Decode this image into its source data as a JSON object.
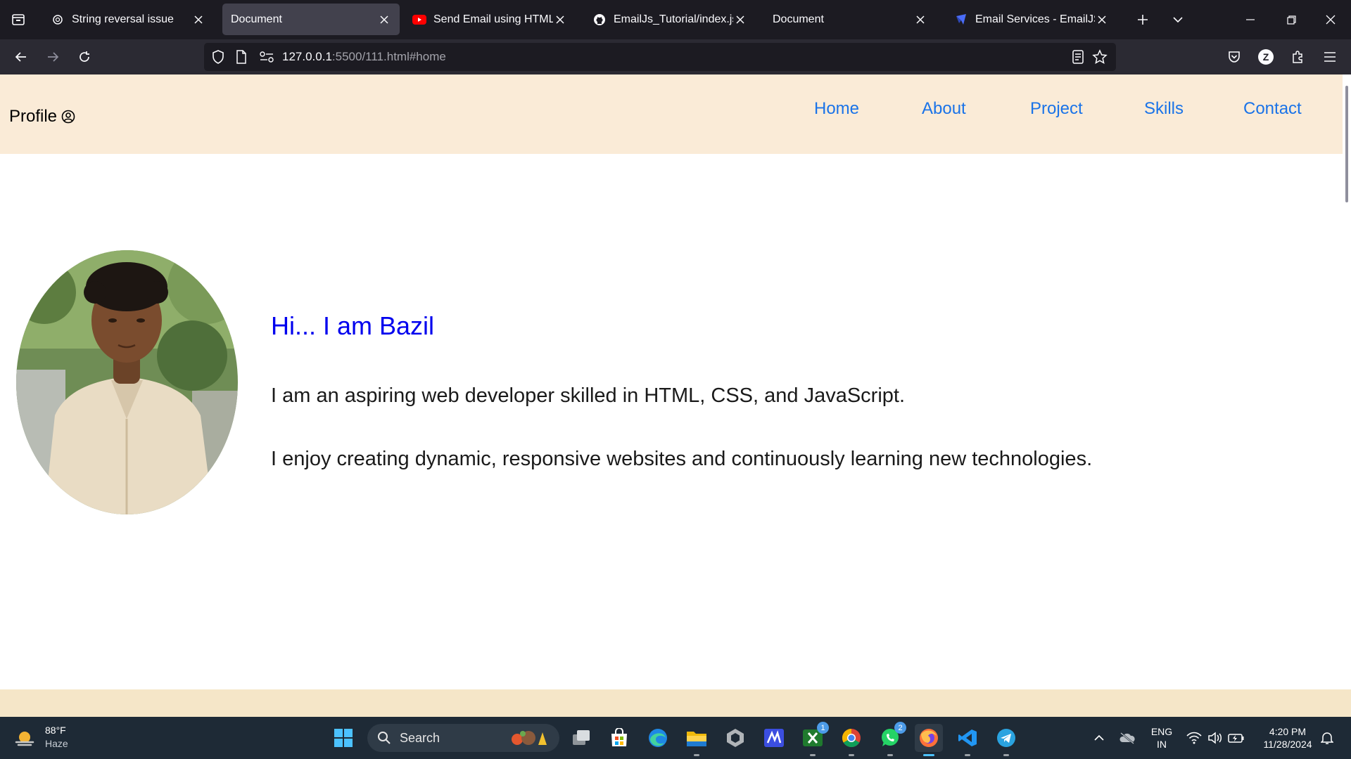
{
  "browser": {
    "tabs": [
      {
        "title": "String reversal issue",
        "icon": "chatgpt-icon",
        "active": false
      },
      {
        "title": "Document",
        "icon": "none",
        "active": true
      },
      {
        "title": "Send Email using HTML + JavaScript",
        "icon": "youtube-icon",
        "active": false
      },
      {
        "title": "EmailJs_Tutorial/index.js at main",
        "icon": "github-icon",
        "active": false
      },
      {
        "title": "Document",
        "icon": "none",
        "active": false
      },
      {
        "title": "Email Services - EmailJS",
        "icon": "emailjs-icon",
        "active": false
      }
    ],
    "url_host": "127.0.0.1",
    "url_rest": ":5500/111.html#home",
    "profile_initial": "Z"
  },
  "site": {
    "brand": "Profile",
    "nav": {
      "home": "Home",
      "about": "About",
      "project": "Project",
      "skills": "Skills",
      "contact": "Contact"
    },
    "intro": {
      "heading": "Hi... I am Bazil",
      "line1": "I am an aspiring web developer skilled in HTML, CSS, and JavaScript.",
      "line2": "I enjoy creating dynamic, responsive websites and continuously learning new technologies."
    },
    "colors": {
      "header_bg": "#faebd7",
      "nav_link": "#1a73e8",
      "heading": "#0000ee"
    }
  },
  "taskbar": {
    "weather_temp": "88°F",
    "weather_desc": "Haze",
    "search_placeholder": "Search",
    "xbox_badge": "1",
    "whatsapp_badge": "2",
    "lang_line1": "ENG",
    "lang_line2": "IN",
    "time": "4:20 PM",
    "date": "11/28/2024"
  }
}
